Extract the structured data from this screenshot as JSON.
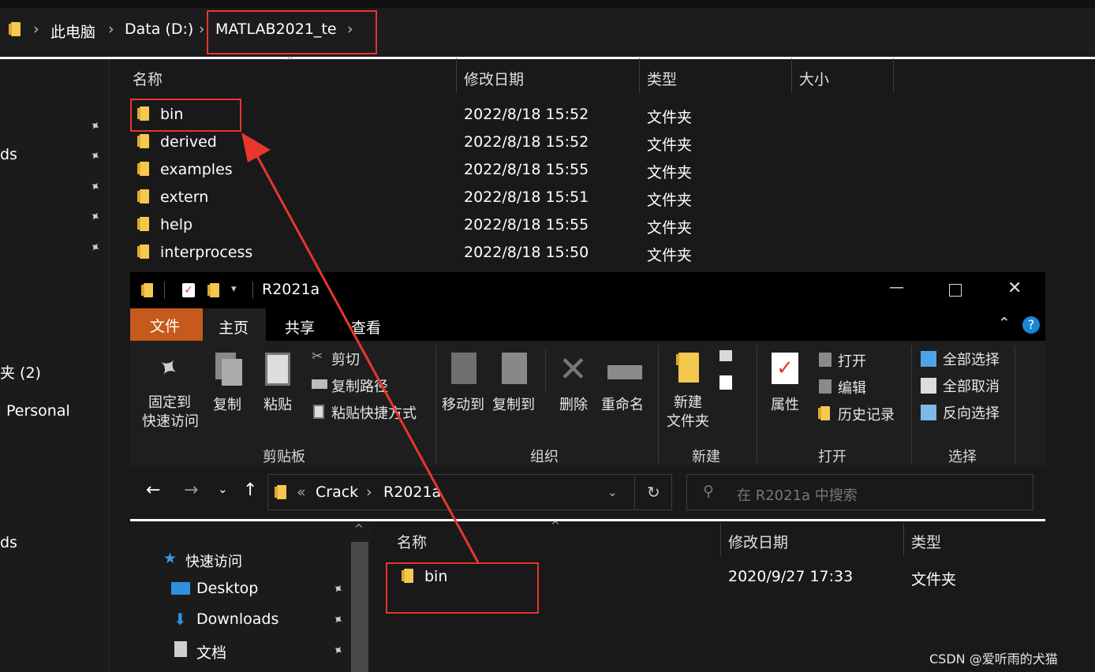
{
  "back_window": {
    "breadcrumb": [
      "此电脑",
      "Data (D:)",
      "MATLAB2021_te"
    ],
    "columns": {
      "name": "名称",
      "modified": "修改日期",
      "type": "类型",
      "size": "大小"
    },
    "rows": [
      {
        "name": "bin",
        "modified": "2022/8/18 15:52",
        "type": "文件夹"
      },
      {
        "name": "derived",
        "modified": "2022/8/18 15:52",
        "type": "文件夹"
      },
      {
        "name": "examples",
        "modified": "2022/8/18 15:55",
        "type": "文件夹"
      },
      {
        "name": "extern",
        "modified": "2022/8/18 15:51",
        "type": "文件夹"
      },
      {
        "name": "help",
        "modified": "2022/8/18 15:55",
        "type": "文件夹"
      },
      {
        "name": "interprocess",
        "modified": "2022/8/18 15:50",
        "type": "文件夹"
      }
    ],
    "sidebar_fragments": [
      "ds",
      "夹 (2)",
      "Personal",
      "ds"
    ]
  },
  "front_window": {
    "title": "R2021a",
    "tabs": {
      "file": "文件",
      "home": "主页",
      "share": "共享",
      "view": "查看"
    },
    "ribbon": {
      "pin_quick_access": "固定到\n快速访问",
      "copy": "复制",
      "paste": "粘贴",
      "cut": "剪切",
      "copy_path": "复制路径",
      "paste_shortcut": "粘贴快捷方式",
      "move_to": "移动到",
      "copy_to": "复制到",
      "delete": "删除",
      "rename": "重命名",
      "new_folder": "新建\n文件夹",
      "properties": "属性",
      "open": "打开",
      "edit": "编辑",
      "history": "历史记录",
      "select_all": "全部选择",
      "select_none": "全部取消",
      "invert_selection": "反向选择",
      "group_clipboard": "剪贴板",
      "group_organize": "组织",
      "group_new": "新建",
      "group_open": "打开",
      "group_select": "选择"
    },
    "address": {
      "overflow": "«",
      "crumbs": [
        "Crack",
        "R2021a"
      ]
    },
    "search_placeholder": "在 R2021a 中搜索",
    "columns": {
      "name": "名称",
      "modified": "修改日期",
      "type": "类型"
    },
    "rows": [
      {
        "name": "bin",
        "modified": "2020/9/27 17:33",
        "type": "文件夹"
      }
    ],
    "sidebar": {
      "quick_access": "快速访问",
      "items": [
        "Desktop",
        "Downloads",
        "文档"
      ]
    }
  },
  "watermark": "CSDN @爱听雨的犬猫",
  "colors": {
    "highlight_box": "#e8362b",
    "arrow": "#e8362b",
    "file_tab": "#c65a1c",
    "folder": "#f5c84f"
  }
}
